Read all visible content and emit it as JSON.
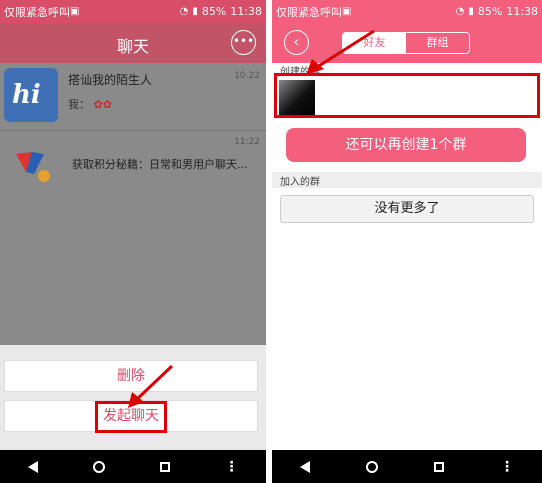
{
  "left_phone": {
    "status": {
      "carrier": "仅限紧急呼叫",
      "battery": "85%",
      "time": "11:38"
    },
    "header": {
      "title": "聊天",
      "more_icon": "more-horizontal-icon"
    },
    "chats": [
      {
        "name": "搭讪我的陌生人",
        "preview": "我：",
        "time": "10:22",
        "avatar_text": "hi"
      },
      {
        "name": "",
        "preview": "获取积分秘籍：日常和男用户聊天...",
        "time": "11:22"
      }
    ],
    "action_sheet": {
      "delete_label": "删除",
      "start_chat_label": "发起聊天"
    },
    "colors": {
      "accent": "#d84d67",
      "highlight": "#dd0000"
    }
  },
  "right_phone": {
    "status": {
      "carrier": "仅限紧急呼叫",
      "battery": "85%",
      "time": "11:38"
    },
    "header": {
      "tabs": [
        "好友",
        "群组"
      ]
    },
    "sections": {
      "created_label": "创建的群",
      "joined_label": "加入的群"
    },
    "create_button_label": "还可以再创建1个群",
    "no_more_label": "没有更多了",
    "colors": {
      "accent": "#f35f7c"
    }
  },
  "nav_icons": [
    "back-triangle-icon",
    "home-circle-icon",
    "recent-square-icon",
    "menu-dots-icon"
  ]
}
